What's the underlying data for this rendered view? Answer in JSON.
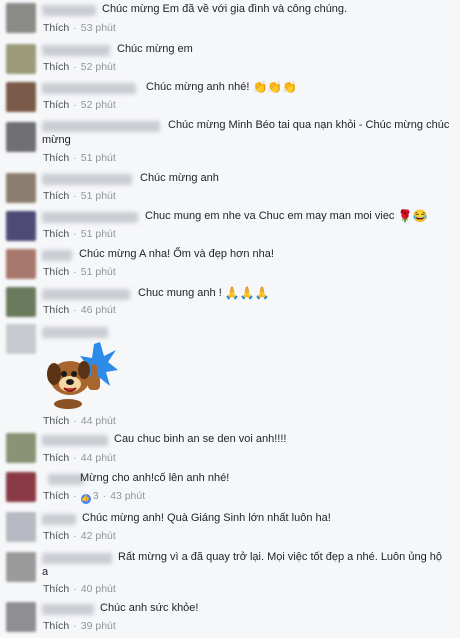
{
  "like_label": "Thích",
  "comments": [
    {
      "text": "Chúc mừng Em đã về với gia đình và công chúng.",
      "time": "53 phút",
      "emoji": []
    },
    {
      "text": "Chúc mừng em",
      "time": "52 phút",
      "emoji": []
    },
    {
      "text": "Chúc mừng anh nhé!",
      "time": "52 phút",
      "emoji": [
        "👏",
        "👏",
        "👏"
      ]
    },
    {
      "text": "Chúc mừng Minh Béo tai qua nạn khỏi - Chúc mừng chúc mừng",
      "time": "51 phút",
      "emoji": []
    },
    {
      "text": "Chúc mừng anh",
      "time": "51 phút",
      "emoji": []
    },
    {
      "text": "Chuc mung em nhe va Chuc em may man moi viec",
      "time": "51 phút",
      "emoji": [
        "🌹",
        "😂"
      ]
    },
    {
      "text": "Chúc mừng A nha! Ốm và đẹp hơn nha!",
      "time": "51 phút",
      "emoji": []
    },
    {
      "text": "Chuc mung anh !",
      "time": "46 phút",
      "emoji": [
        "🙏",
        "🙏",
        "🙏"
      ]
    },
    {
      "text": "",
      "time": "44 phút",
      "emoji": [],
      "sticker": "thumbs-up-dog-sticker"
    },
    {
      "text": "Cau chuc binh an se den voi anh!!!!",
      "time": "44 phút",
      "emoji": []
    },
    {
      "text": "Mừng cho anh!cố lên anh nhé!",
      "time": "43 phút",
      "emoji": [],
      "reactions": "3"
    },
    {
      "text": "Chúc mừng anh! Quà Giáng Sinh lớn nhất luôn ha!",
      "time": "42 phút",
      "emoji": []
    },
    {
      "text": "Rất mừng vì a đã quay trở lại. Mọi việc tốt đẹp a nhé. Luôn ủng hộ a",
      "time": "40 phút",
      "emoji": []
    },
    {
      "text": "Chúc anh sức khỏe!",
      "time": "39 phút",
      "emoji": []
    }
  ],
  "colors": {
    "text": "#1d2129",
    "meta": "#90949c",
    "reaction_blue": "#4080ff",
    "background": "#f6f7f9"
  }
}
